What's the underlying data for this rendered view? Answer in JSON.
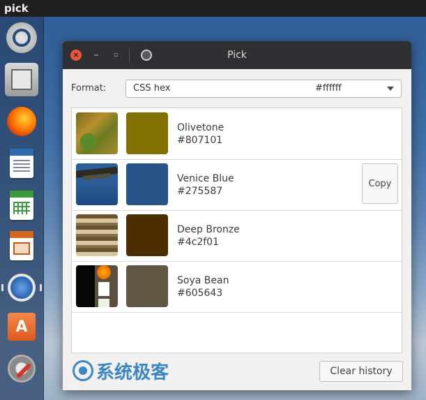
{
  "top_panel": {
    "app_name": "pick"
  },
  "launcher": {
    "items": [
      {
        "icon": "ubuntu-dash-icon"
      },
      {
        "icon": "files-icon"
      },
      {
        "icon": "firefox-icon"
      },
      {
        "icon": "writer-icon"
      },
      {
        "icon": "calc-icon"
      },
      {
        "icon": "impress-icon"
      },
      {
        "icon": "pick-icon"
      },
      {
        "icon": "software-center-icon",
        "glyph": "A"
      },
      {
        "icon": "system-settings-icon"
      }
    ]
  },
  "window": {
    "title": "Pick",
    "format_label": "Format:",
    "format_select": {
      "selected": "CSS hex",
      "preview_value": "#ffffff"
    },
    "history": [
      {
        "name": "Olivetone",
        "hex": "#807101",
        "color": "#807101"
      },
      {
        "name": "Venice Blue",
        "hex": "#275587",
        "color": "#275587",
        "copy_label": "Copy"
      },
      {
        "name": "Deep Bronze",
        "hex": "#4c2f01",
        "color": "#4c2f01"
      },
      {
        "name": "Soya Bean",
        "hex": "#605643",
        "color": "#605643"
      }
    ],
    "watermark_text": "系统极客",
    "clear_history_label": "Clear history"
  }
}
